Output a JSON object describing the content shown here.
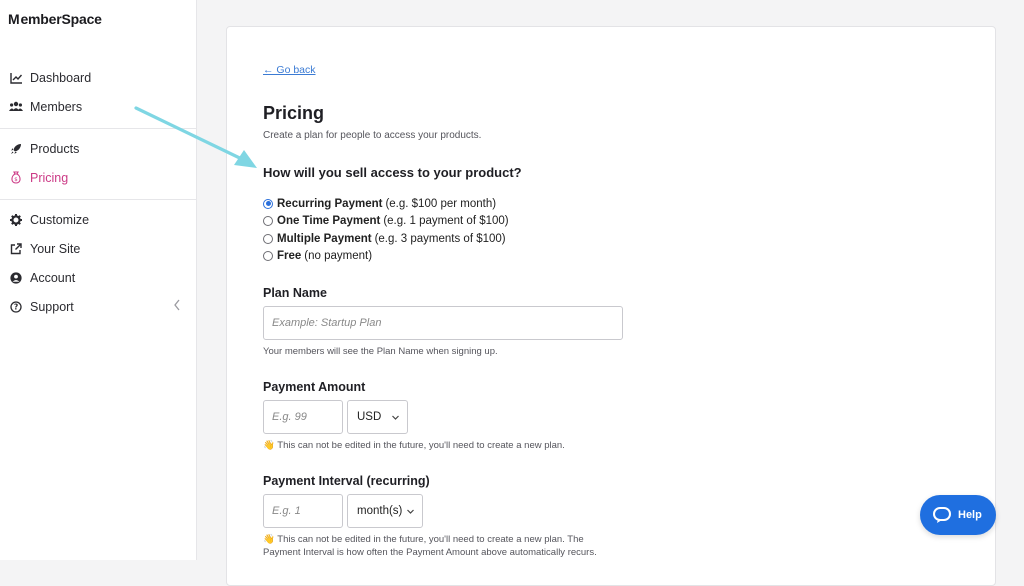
{
  "app": {
    "logo_text": "emberSpace",
    "logo_mark": "M"
  },
  "sidebar": {
    "items": [
      {
        "label": "Dashboard",
        "icon": "chart-line-icon"
      },
      {
        "label": "Members",
        "icon": "users-icon"
      },
      {
        "label": "Products",
        "icon": "rocket-icon"
      },
      {
        "label": "Pricing",
        "icon": "money-bag-icon",
        "active": true
      },
      {
        "label": "Customize",
        "icon": "gear-icon"
      },
      {
        "label": "Your Site",
        "icon": "external-link-icon"
      },
      {
        "label": "Account",
        "icon": "user-circle-icon"
      },
      {
        "label": "Support",
        "icon": "question-circle-icon"
      }
    ]
  },
  "main": {
    "go_back": "← Go back",
    "title": "Pricing",
    "subtitle": "Create a plan for people to access your products.",
    "question": "How will you sell access to your product?",
    "options": [
      {
        "strong": "Recurring Payment",
        "rest": "(e.g. $100 per month)",
        "checked": true
      },
      {
        "strong": "One Time Payment",
        "rest": "(e.g. 1 payment of $100)",
        "checked": false
      },
      {
        "strong": "Multiple Payment",
        "rest": "(e.g. 3 payments of $100)",
        "checked": false
      },
      {
        "strong": "Free",
        "rest": "(no payment)",
        "checked": false
      }
    ],
    "plan_name": {
      "label": "Plan Name",
      "placeholder": "Example: Startup Plan",
      "hint": "Your members will see the Plan Name when signing up."
    },
    "payment_amount": {
      "label": "Payment Amount",
      "placeholder": "E.g. 99",
      "currency": "USD",
      "hint": "👋 This can not be edited in the future, you'll need to create a new plan."
    },
    "payment_interval": {
      "label": "Payment Interval (recurring)",
      "placeholder": "E.g. 1",
      "unit": "month(s)",
      "hint_line1": "👋 This can not be edited in the future, you'll need to create a new plan. The",
      "hint_line2": "Payment Interval is how often the Payment Amount above automatically recurs."
    }
  },
  "help": {
    "label": "Help"
  },
  "colors": {
    "accent": "#cc3a86",
    "link": "#3b7bd4",
    "help_button": "#1f6fe0",
    "annotation_arrow": "#7fd6e3"
  }
}
